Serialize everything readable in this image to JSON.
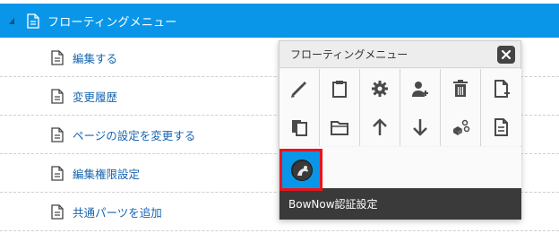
{
  "tree": {
    "header_label": "フローティングメニュー",
    "items": [
      {
        "label": "編集する"
      },
      {
        "label": "変更履歴"
      },
      {
        "label": "ページの設定を変更する"
      },
      {
        "label": "編集権限設定"
      },
      {
        "label": "共通パーツを追加"
      }
    ]
  },
  "floating_menu": {
    "title": "フローティングメニュー",
    "close_icon": "close-icon",
    "row1_icons": [
      "pencil-icon",
      "clipboard-icon",
      "gear-icon",
      "add-user-icon",
      "trash-icon",
      "new-document-icon"
    ],
    "row2_icons": [
      "copy-icon",
      "folder-icon",
      "arrow-up-icon",
      "arrow-down-icon",
      "parts-icon",
      "document-icon"
    ],
    "selected_item_tooltip": "BowNow認証設定"
  },
  "colors": {
    "accent": "#0a96e8",
    "highlight": "#e8141c",
    "tooltip_bg": "#3a3a3a"
  }
}
